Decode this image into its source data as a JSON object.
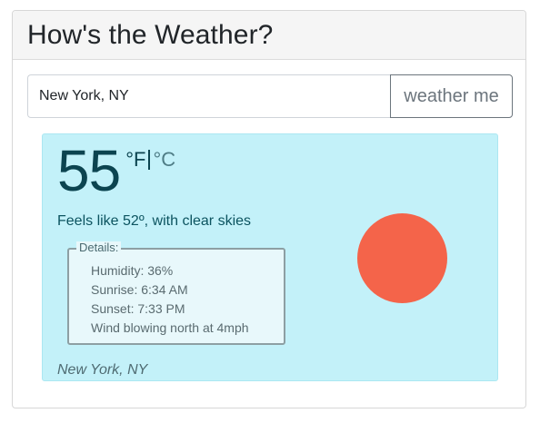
{
  "header": {
    "title": "How's the Weather?"
  },
  "search": {
    "value": "New York, NY",
    "placeholder": "",
    "button_label": "weather me"
  },
  "weather": {
    "temperature": "55",
    "unit_fahrenheit": "°F",
    "unit_celsius": "°C",
    "active_unit": "F",
    "feels_like": "Feels like 52º, with clear skies",
    "details_legend": "Details:",
    "details": {
      "humidity": "Humidity: 36%",
      "sunrise": "Sunrise: 6:34 AM",
      "sunset": "Sunset: 7:33 PM",
      "wind": "Wind blowing north at 4mph"
    },
    "icon": "sun-icon",
    "location": "New York, NY"
  },
  "colors": {
    "panel_bg": "#c3f1f9",
    "sun": "#f4644a",
    "text_dark": "#0c4450"
  }
}
